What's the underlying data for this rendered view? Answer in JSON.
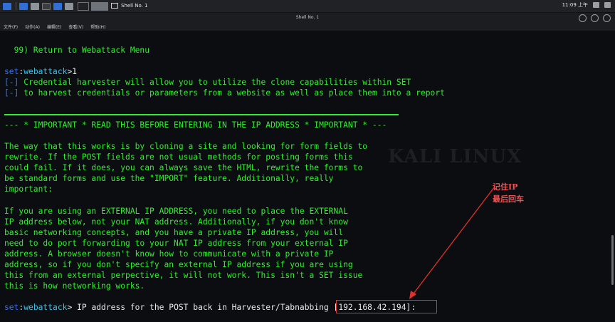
{
  "taskbar": {
    "task_title": "Shell No. 1",
    "clock": "11:09 上午"
  },
  "window": {
    "title": "Shell No. 1",
    "menu": [
      "文件(F)",
      "动作(A)",
      "编辑(E)",
      "查看(V)",
      "帮助(H)"
    ]
  },
  "terminal": {
    "menu_option": "  99) Return to Webattack Menu",
    "prompt1_set": "set",
    "prompt1_colon": ":",
    "prompt1_ctx": "webattack",
    "prompt1_rest": ">1",
    "info_marker": "[-]",
    "info_line1": " Credential harvester will allow you to utilize the clone capabilities within SET",
    "info_line2": " to harvest credentials or parameters from a website as well as place them into a report",
    "important": "--- * IMPORTANT * READ THIS BEFORE ENTERING IN THE IP ADDRESS * IMPORTANT * ---",
    "para1": [
      "The way that this works is by cloning a site and looking for form fields to",
      "rewrite. If the POST fields are not usual methods for posting forms this",
      "could fail. If it does, you can always save the HTML, rewrite the forms to",
      "be standard forms and use the \"IMPORT\" feature. Additionally, really",
      "important:"
    ],
    "para2": [
      "If you are using an EXTERNAL IP ADDRESS, you need to place the EXTERNAL",
      "IP address below, not your NAT address. Additionally, if you don't know",
      "basic networking concepts, and you have a private IP address, you will",
      "need to do port forwarding to your NAT IP address from your external IP",
      "address. A browser doesn't know how to communicate with a private IP",
      "address, so if you don't specify an external IP address if you are using",
      "this from an external perpective, it will not work. This isn't a SET issue",
      "this is how networking works."
    ],
    "prompt2_set": "set",
    "prompt2_colon": ":",
    "prompt2_ctx": "webattack",
    "prompt2_text": "> IP address for the POST back in Harvester/Tabnabbing ",
    "prompt2_default": "[192.168.42.194]",
    "prompt2_end": ":",
    "watermark": "KALI LINUX"
  },
  "annotation": {
    "line1": "记住IP",
    "line2": "最后回车"
  },
  "colors": {
    "terminal_green": "#2ef02e",
    "prompt_blue": "#3b73e6",
    "prompt_cyan": "#37c3ea",
    "annotation_red": "#e3302d"
  }
}
